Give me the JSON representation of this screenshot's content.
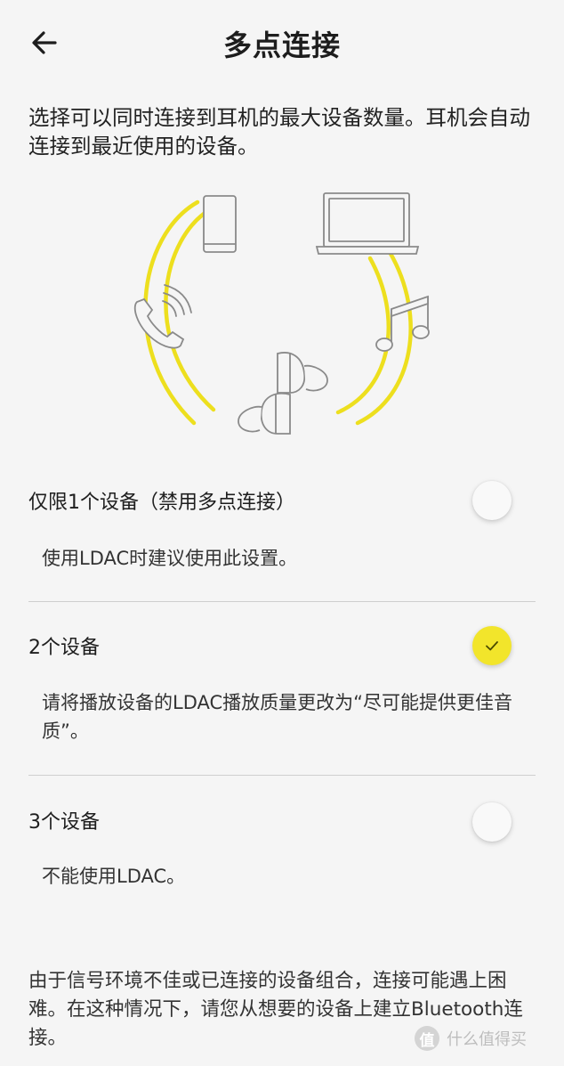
{
  "header": {
    "title": "多点连接"
  },
  "intro_text": "选择可以同时连接到耳机的最大设备数量。耳机会自动连接到最近使用的设备。",
  "options": [
    {
      "label": "仅限1个设备（禁用多点连接）",
      "description": "使用LDAC时建议使用此设置。",
      "selected": false
    },
    {
      "label": "2个设备",
      "description": "请将播放设备的LDAC播放质量更改为“尽可能提供更佳音质”。",
      "selected": true
    },
    {
      "label": "3个设备",
      "description": "不能使用LDAC。",
      "selected": false
    }
  ],
  "footer_text": "由于信号环境不佳或已连接的设备组合，连接可能遇上困难。在这种情况下，请您从想要的设备上建立Bluetooth连接。",
  "watermark": {
    "logo": "值",
    "text": "什么值得买"
  },
  "colors": {
    "accent_yellow": "#f2e52b",
    "arc_yellow": "#eddf1e",
    "background": "#f5f5f5",
    "text": "#222222",
    "line_art": "#8a8a8a"
  },
  "icons": {
    "back": "arrow-left-icon",
    "check": "check-icon",
    "phone": "phone-icon",
    "laptop": "laptop-icon",
    "call": "call-icon",
    "music": "music-note-icon",
    "earbuds": "earbuds-icon"
  }
}
